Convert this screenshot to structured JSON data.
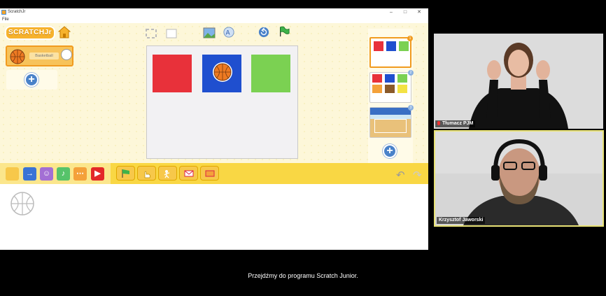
{
  "window": {
    "title": "ScratchJr",
    "menu_file": "File",
    "min_glyph": "–",
    "max_glyph": "□",
    "close_glyph": "✕"
  },
  "app": {
    "logo_text": "SCRATCHJr",
    "sprite": {
      "name": "Basketball"
    },
    "stage_colors": [
      "#e8313a",
      "#1f4fcf",
      "#7bd152"
    ],
    "pages": [
      {
        "num": "1",
        "selected": true
      },
      {
        "num": "2",
        "selected": false
      },
      {
        "num": "3",
        "selected": false
      }
    ],
    "categories": [
      {
        "name": "triggering",
        "color": "#f7c84a",
        "glyph": ""
      },
      {
        "name": "motion",
        "color": "#3a73d6",
        "glyph": "→"
      },
      {
        "name": "looks",
        "color": "#a36fd4",
        "glyph": "☺"
      },
      {
        "name": "sound",
        "color": "#56c36a",
        "glyph": "♪"
      },
      {
        "name": "control",
        "color": "#f4a13a",
        "glyph": "⋯"
      },
      {
        "name": "end",
        "color": "#e32828",
        "glyph": "▶"
      }
    ],
    "blocks": [
      "green-flag",
      "on-tap",
      "on-bump",
      "receive-message",
      "send-message"
    ],
    "undo_glyph": "↶",
    "redo_glyph": "↷"
  },
  "video": {
    "interpreter_label": "Tłumacz PJM",
    "speaker_label": "Krzysztof Jaworski"
  },
  "subtitle": "Przejdźmy do programu Scratch Junior."
}
